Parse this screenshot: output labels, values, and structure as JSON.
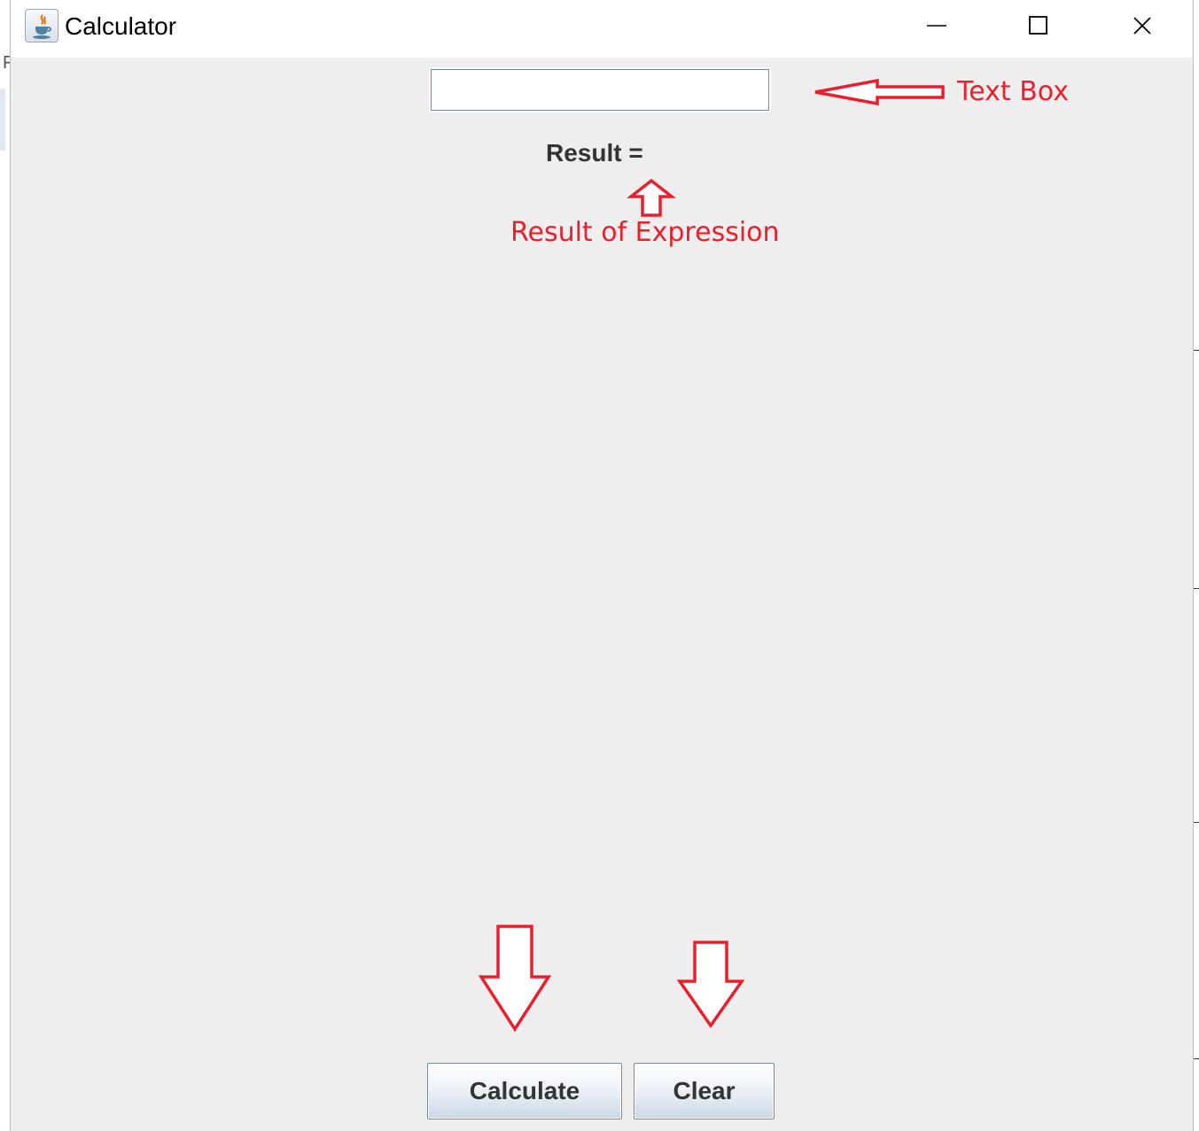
{
  "window": {
    "title": "Calculator",
    "controls": [
      "minimize",
      "maximize",
      "close"
    ]
  },
  "form": {
    "expression_input": {
      "value": "",
      "placeholder": ""
    },
    "result_label": "Result ="
  },
  "buttons": {
    "calculate_label": "Calculate",
    "clear_label": "Clear"
  },
  "annotations": {
    "text_box_label": "Text Box",
    "result_label": "Result of Expression",
    "color": "#e8202e"
  },
  "background": {
    "left_edge_char": "F"
  },
  "colors": {
    "window_background": "#eeeeee",
    "titlebar_background": "#ffffff",
    "annotation_red": "#e8202e",
    "label_text": "#333333"
  }
}
